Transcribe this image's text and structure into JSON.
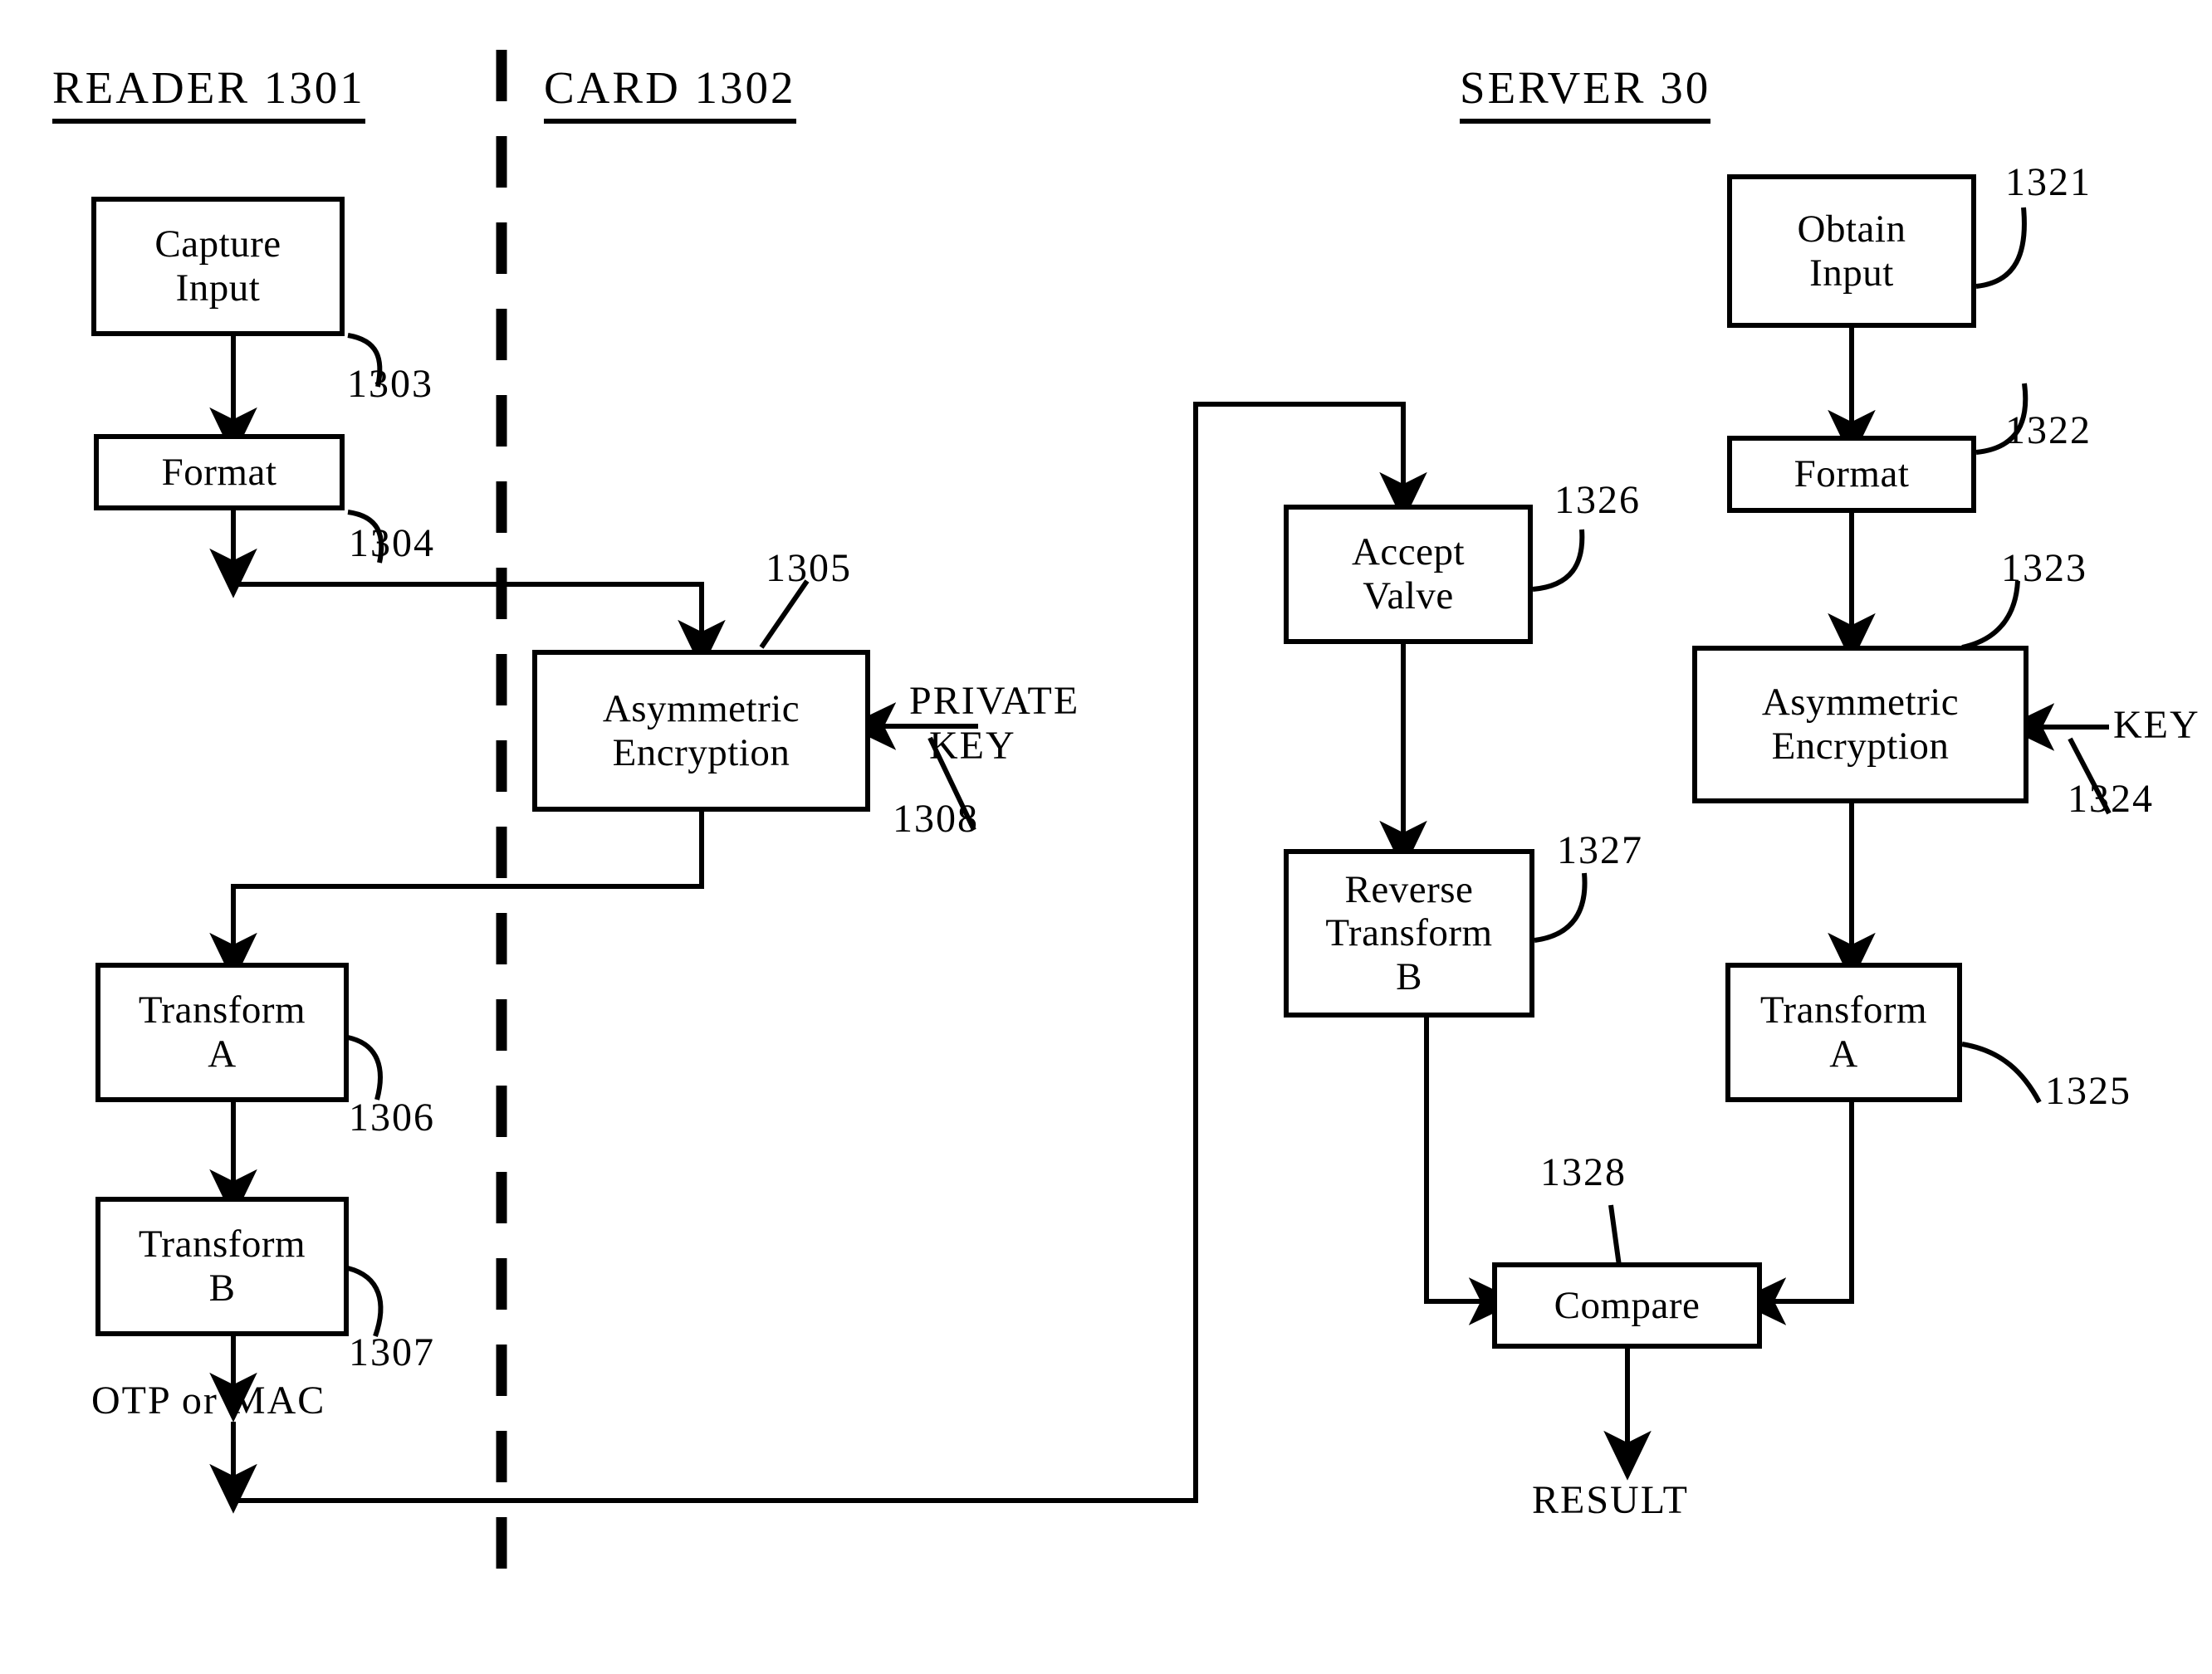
{
  "figure": {
    "type": "patent-flow-diagram",
    "columns": [
      {
        "id": "reader",
        "title": "READER  1301"
      },
      {
        "id": "card",
        "title": "CARD  1302"
      },
      {
        "id": "server",
        "title": "SERVER  30"
      }
    ],
    "boxes": [
      {
        "id": "capture-input",
        "column": "reader",
        "lines": [
          "Capture",
          "Input"
        ]
      },
      {
        "id": "format-reader",
        "column": "reader",
        "lines": [
          "Format"
        ]
      },
      {
        "id": "asymmetric-card",
        "column": "card",
        "lines": [
          "Asymmetric",
          "Encryption"
        ]
      },
      {
        "id": "transform-a-reader",
        "column": "reader",
        "lines": [
          "Transform",
          "A"
        ]
      },
      {
        "id": "transform-b-reader",
        "column": "reader",
        "lines": [
          "Transform",
          "B"
        ]
      },
      {
        "id": "accept-valve",
        "column": "server",
        "lines": [
          "Accept",
          "Valve"
        ]
      },
      {
        "id": "reverse-transform-b",
        "column": "server",
        "lines": [
          "Reverse",
          "Transform",
          "B"
        ]
      },
      {
        "id": "compare",
        "column": "server",
        "lines": [
          "Compare"
        ]
      },
      {
        "id": "obtain-input",
        "column": "server",
        "lines": [
          "Obtain",
          "Input"
        ]
      },
      {
        "id": "format-server",
        "column": "server",
        "lines": [
          "Format"
        ]
      },
      {
        "id": "asymmetric-server",
        "column": "server",
        "lines": [
          "Asymmetric",
          "Encryption"
        ]
      },
      {
        "id": "transform-a-server",
        "column": "server",
        "lines": [
          "Transform",
          "A"
        ]
      }
    ],
    "reference_numerals": [
      {
        "id": "ref-1303",
        "value": "1303",
        "points_to": "capture-input"
      },
      {
        "id": "ref-1304",
        "value": "1304",
        "points_to": "format-reader"
      },
      {
        "id": "ref-1305",
        "value": "1305",
        "points_to": "asymmetric-card"
      },
      {
        "id": "ref-1306",
        "value": "1306",
        "points_to": "transform-a-reader"
      },
      {
        "id": "ref-1307",
        "value": "1307",
        "points_to": "transform-b-reader"
      },
      {
        "id": "ref-1308",
        "value": "1308",
        "points_to": "private-key-input"
      },
      {
        "id": "ref-1321",
        "value": "1321",
        "points_to": "obtain-input"
      },
      {
        "id": "ref-1322",
        "value": "1322",
        "points_to": "format-server"
      },
      {
        "id": "ref-1323",
        "value": "1323",
        "points_to": "asymmetric-server"
      },
      {
        "id": "ref-1324",
        "value": "1324",
        "points_to": "key-input"
      },
      {
        "id": "ref-1325",
        "value": "1325",
        "points_to": "transform-a-server"
      },
      {
        "id": "ref-1326",
        "value": "1326",
        "points_to": "accept-valve"
      },
      {
        "id": "ref-1327",
        "value": "1327",
        "points_to": "reverse-transform-b"
      },
      {
        "id": "ref-1328",
        "value": "1328",
        "points_to": "compare"
      }
    ],
    "labels": [
      {
        "id": "private-key",
        "lines": [
          "PRIVATE",
          "KEY"
        ]
      },
      {
        "id": "key",
        "lines": [
          "KEY"
        ]
      },
      {
        "id": "otp-or-mac",
        "lines": [
          "OTP  or  MAC"
        ]
      },
      {
        "id": "result",
        "lines": [
          "RESULT"
        ]
      }
    ],
    "colors": {
      "ink": "#000000",
      "background": "#ffffff"
    },
    "divider": {
      "id": "reader-card-divider",
      "style": "dashed-vertical"
    }
  }
}
